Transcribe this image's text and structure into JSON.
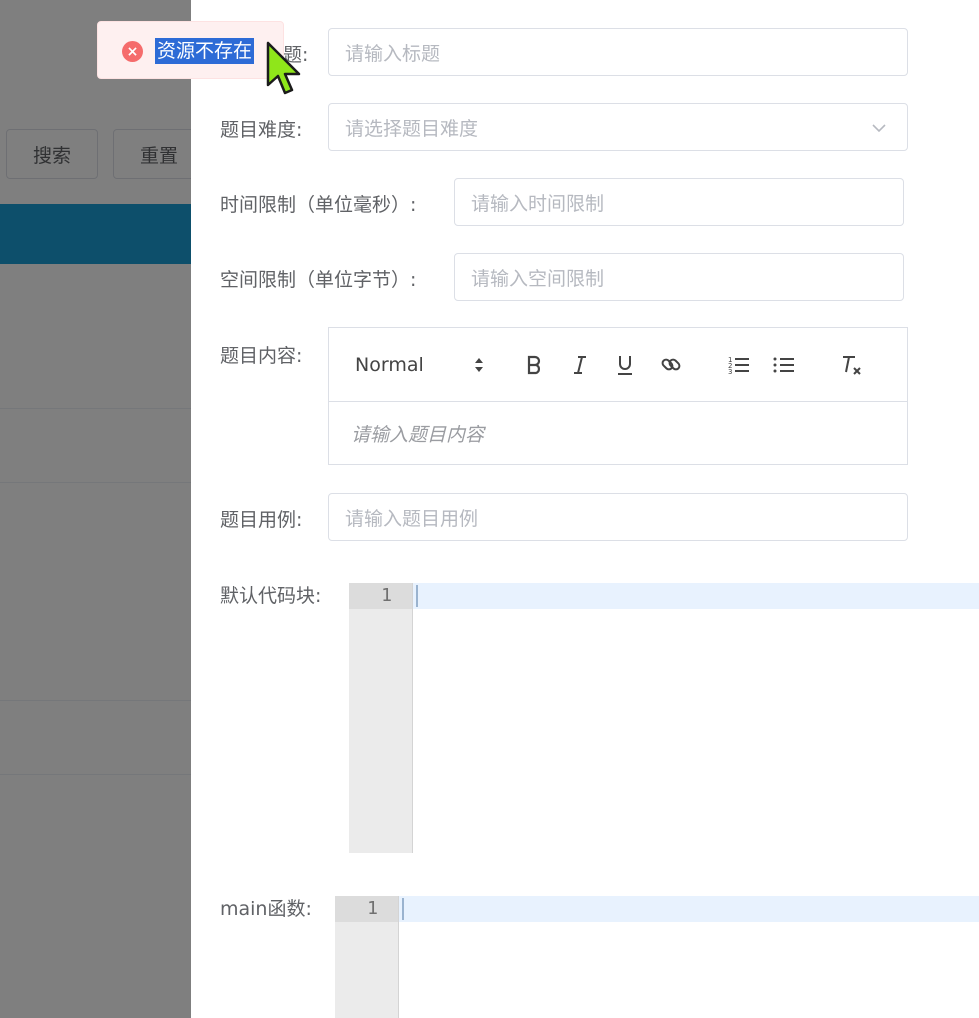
{
  "background": {
    "buttons": {
      "search": "搜索",
      "reset": "重置"
    },
    "header_color": "#1a9fd6"
  },
  "toast": {
    "type": "error",
    "message": "资源不存在",
    "icon": "close-circle-icon",
    "color": "#f56c6c"
  },
  "form": {
    "title": {
      "label_visible": "题:",
      "placeholder": "请输入标题"
    },
    "difficulty": {
      "label": "题目难度:",
      "placeholder": "请选择题目难度",
      "icon": "chevron-down-icon"
    },
    "time_limit": {
      "label": "时间限制（单位毫秒）:",
      "placeholder": "请输入时间限制"
    },
    "space_limit": {
      "label": "空间限制（单位字节）:",
      "placeholder": "请输入空间限制"
    },
    "content": {
      "label": "题目内容:",
      "toolbar": {
        "header_select": "Normal",
        "buttons": [
          "bold",
          "italic",
          "underline",
          "link",
          "ordered-list",
          "bullet-list",
          "clean"
        ]
      },
      "placeholder": "请输入题目内容"
    },
    "example": {
      "label": "题目用例:",
      "placeholder": "请输入题目用例"
    },
    "default_code": {
      "label": "默认代码块:",
      "line_number": "1"
    },
    "main_function": {
      "label": "main函数:",
      "line_number": "1"
    }
  }
}
